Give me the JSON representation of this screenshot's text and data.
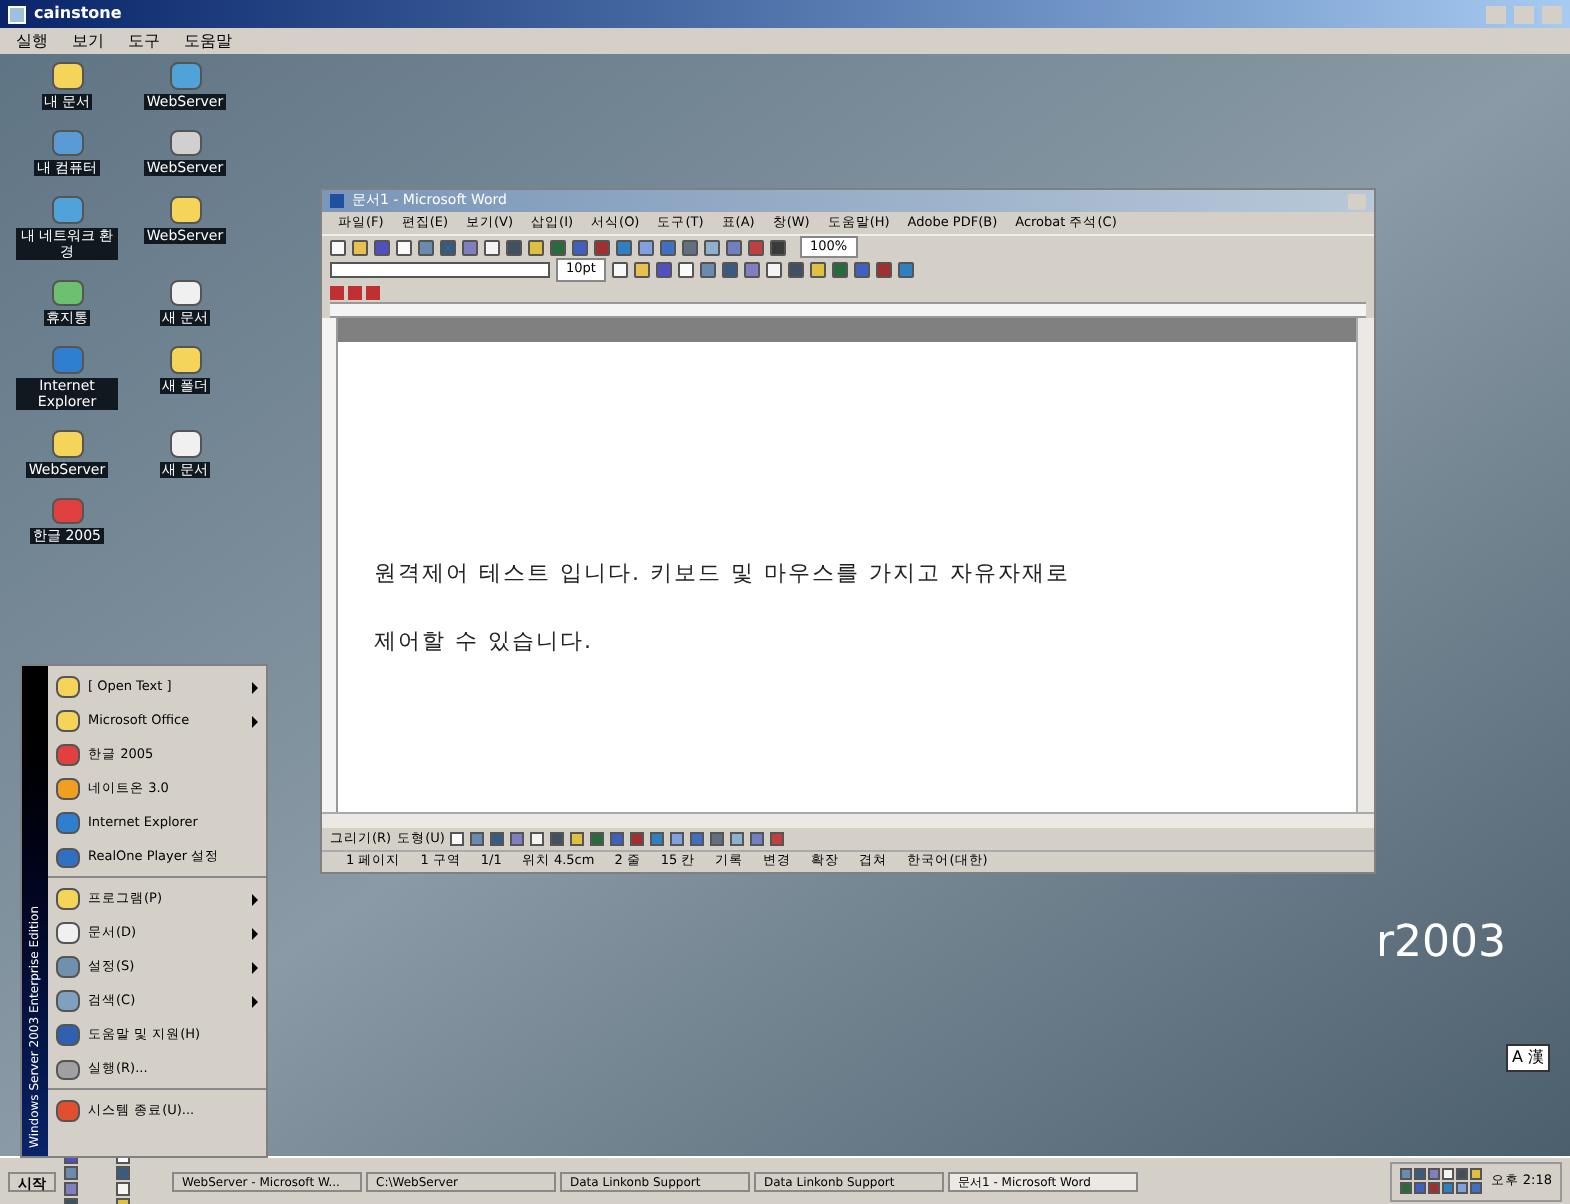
{
  "window": {
    "title": "cainstone"
  },
  "menu": [
    "실행",
    "보기",
    "도구",
    "도움말"
  ],
  "desktop_icons": [
    {
      "label": "내 문서",
      "kind": "folder"
    },
    {
      "label": "WebServer",
      "kind": "network"
    },
    {
      "label": "내 컴퓨터",
      "kind": "computer"
    },
    {
      "label": "WebServer",
      "kind": "disk"
    },
    {
      "label": "내 네트워크 환경",
      "kind": "network"
    },
    {
      "label": "WebServer",
      "kind": "folder"
    },
    {
      "label": "휴지통",
      "kind": "bin"
    },
    {
      "label": "새 문서",
      "kind": "doc"
    },
    {
      "label": "Internet Explorer",
      "kind": "ie"
    },
    {
      "label": "새 폴더",
      "kind": "folder"
    },
    {
      "label": "WebServer",
      "kind": "folder"
    },
    {
      "label": "새 문서",
      "kind": "doc"
    },
    {
      "label": "한글 2005",
      "kind": "hwp"
    }
  ],
  "wallpaper_text": "r2003",
  "ime_indicator": "A 漢",
  "word": {
    "title": "문서1 - Microsoft Word",
    "menu": [
      "파일(F)",
      "편집(E)",
      "보기(V)",
      "삽입(I)",
      "서식(O)",
      "도구(T)",
      "표(A)",
      "창(W)",
      "도움말(H)",
      "Adobe PDF(B)",
      "Acrobat 주석(C)"
    ],
    "zoom": "100%",
    "font_size": "10pt",
    "paragraphs": [
      "원격제어 테스트 입니다. 키보드 및 마우스를 가지고 자유자재로",
      "제어할 수 있습니다."
    ],
    "draw_toolbar": [
      "그리기(R)",
      "도형(U)"
    ],
    "status": [
      "1 페이지",
      "1 구역",
      "1/1",
      "위치 4.5cm",
      "2 줄",
      "15 칸",
      "기록",
      "변경",
      "확장",
      "겹쳐",
      "한국어(대한)"
    ]
  },
  "start_menu": {
    "banner": "Windows Server 2003 Enterprise Edition",
    "items": [
      {
        "label": "[ Open Text ]",
        "kind": "folder",
        "submenu": true,
        "divider_after": false
      },
      {
        "label": "Microsoft Office",
        "kind": "folder",
        "submenu": true,
        "divider_after": false
      },
      {
        "label": "한글 2005",
        "kind": "hwp",
        "submenu": false,
        "divider_after": false
      },
      {
        "label": "네이트온 3.0",
        "kind": "messenger",
        "submenu": false,
        "divider_after": false
      },
      {
        "label": "Internet Explorer",
        "kind": "ie",
        "submenu": false,
        "divider_after": false
      },
      {
        "label": "RealOne Player 설정",
        "kind": "player",
        "submenu": false,
        "divider_after": true
      },
      {
        "label": "프로그램(P)",
        "kind": "folder",
        "submenu": true,
        "divider_after": false
      },
      {
        "label": "문서(D)",
        "kind": "doc",
        "submenu": true,
        "divider_after": false
      },
      {
        "label": "설정(S)",
        "kind": "settings",
        "submenu": true,
        "divider_after": false
      },
      {
        "label": "검색(C)",
        "kind": "search",
        "submenu": true,
        "divider_after": false
      },
      {
        "label": "도움말 및 지원(H)",
        "kind": "help",
        "submenu": false,
        "divider_after": false
      },
      {
        "label": "실행(R)...",
        "kind": "run",
        "submenu": false,
        "divider_after": true
      },
      {
        "label": "시스템 종료(U)...",
        "kind": "shutdown",
        "submenu": false,
        "divider_after": false
      }
    ]
  },
  "taskbar": {
    "start": "시작",
    "tasks": [
      {
        "label": "WebServer - Microsoft W...",
        "selected": false
      },
      {
        "label": "C:\\WebServer",
        "selected": false
      },
      {
        "label": "Data Linkonb Support",
        "selected": false
      },
      {
        "label": "Data Linkonb Support",
        "selected": false
      },
      {
        "label": "문서1 - Microsoft Word",
        "selected": true
      }
    ],
    "clock": "오후 2:18"
  }
}
